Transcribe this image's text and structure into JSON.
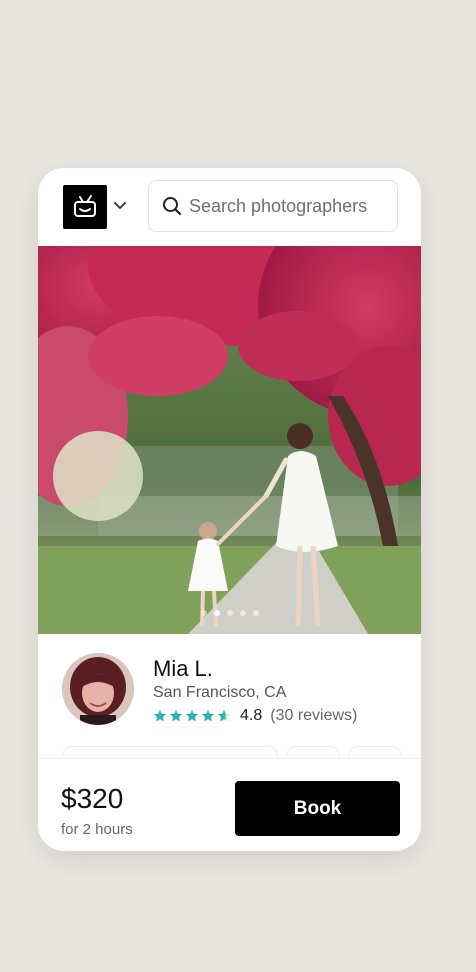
{
  "header": {
    "logo_icon": "tv-camera-logo-icon",
    "menu_chevron_icon": "chevron-down-icon",
    "search": {
      "icon": "search-icon",
      "placeholder": "Search photographers",
      "value": ""
    }
  },
  "gallery": {
    "photo_description_icon": "photo",
    "slide_count": 5,
    "active_slide": 2
  },
  "photographer": {
    "name": "Mia L.",
    "location": "San Francisco, CA",
    "rating": "4.8",
    "stars": 4.5,
    "reviews": "(30 reviews)",
    "star_color": "#2bb5b1"
  },
  "booking": {
    "price": "$320",
    "duration": "for 2 hours",
    "book_label": "Book"
  },
  "colors": {
    "background": "#e9e5e0",
    "card": "#ffffff",
    "primary_button": "#000000",
    "accent": "#2bb5b1"
  }
}
